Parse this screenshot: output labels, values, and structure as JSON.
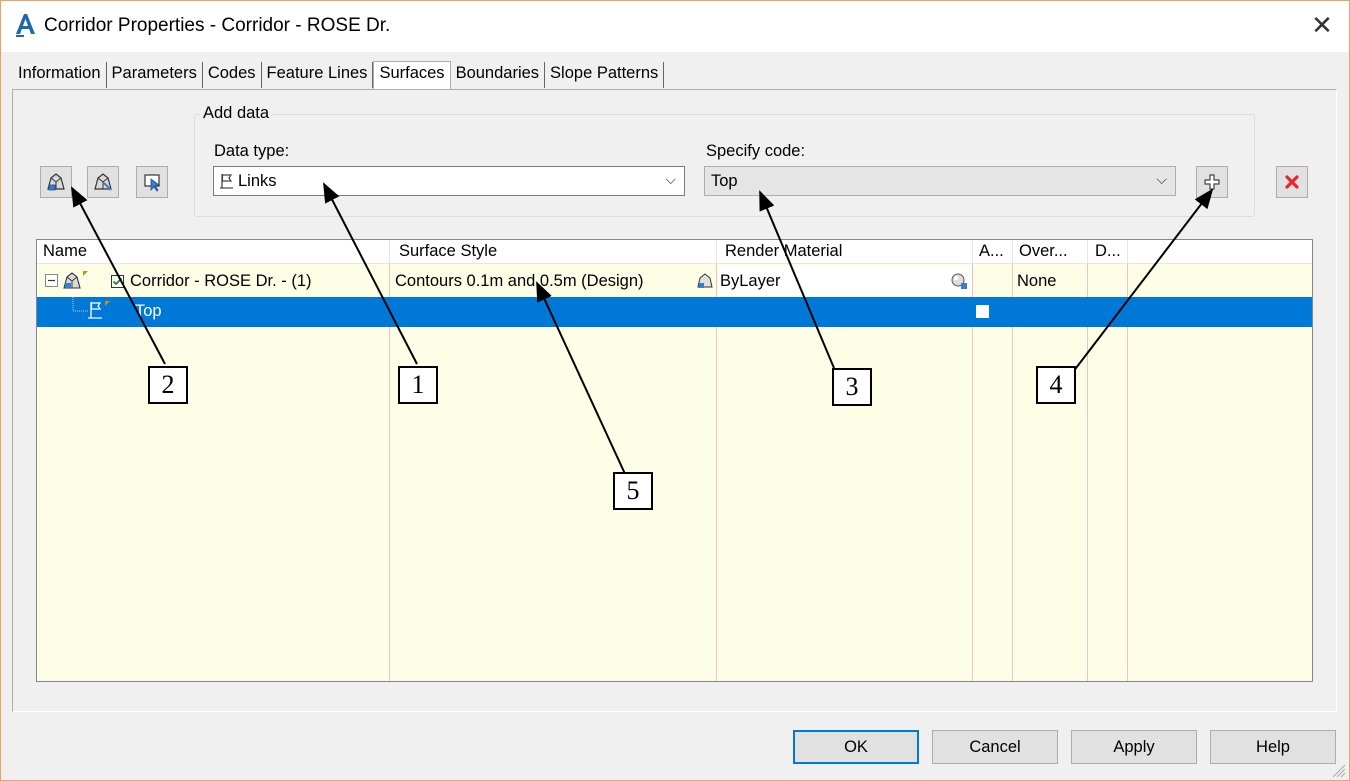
{
  "window": {
    "title": "Corridor Properties - Corridor - ROSE Dr.",
    "close_glyph": "✕"
  },
  "tabs": [
    {
      "label": "Information",
      "active": false
    },
    {
      "label": "Parameters",
      "active": false
    },
    {
      "label": "Codes",
      "active": false
    },
    {
      "label": "Feature Lines",
      "active": false
    },
    {
      "label": "Surfaces",
      "active": true
    },
    {
      "label": "Boundaries",
      "active": false
    },
    {
      "label": "Slope Patterns",
      "active": false
    }
  ],
  "add_data": {
    "group_label": "Add data",
    "data_type_label": "Data type:",
    "data_type_value": "Links",
    "specify_code_label": "Specify code:",
    "specify_code_value": "Top"
  },
  "toolbar_icons": [
    "create-surface-icon",
    "surface-boundary-icon",
    "pick-icon"
  ],
  "grid": {
    "columns": [
      "Name",
      "Surface Style",
      "Render Material",
      "A...",
      "Over...",
      "D..."
    ],
    "rows": [
      {
        "name": "Corridor - ROSE Dr. - (1)",
        "surface_style": "Contours 0.1m and 0.5m (Design)",
        "render_material": "ByLayer",
        "add_as_breakline": "",
        "overhang": "None",
        "d": "",
        "checked": true,
        "selected": false
      },
      {
        "name": "Top",
        "surface_style": "",
        "render_material": "",
        "add_as_breakline": "",
        "overhang": "",
        "d": "",
        "checked": false,
        "selected": true
      }
    ]
  },
  "callouts": [
    "1",
    "2",
    "3",
    "4",
    "5"
  ],
  "buttons": {
    "ok": "OK",
    "cancel": "Cancel",
    "apply": "Apply",
    "help": "Help"
  },
  "colors": {
    "accent": "#0078d7",
    "grid_bg": "#fefde6",
    "delete": "#e8262c",
    "window_border": "#e8a26a"
  }
}
